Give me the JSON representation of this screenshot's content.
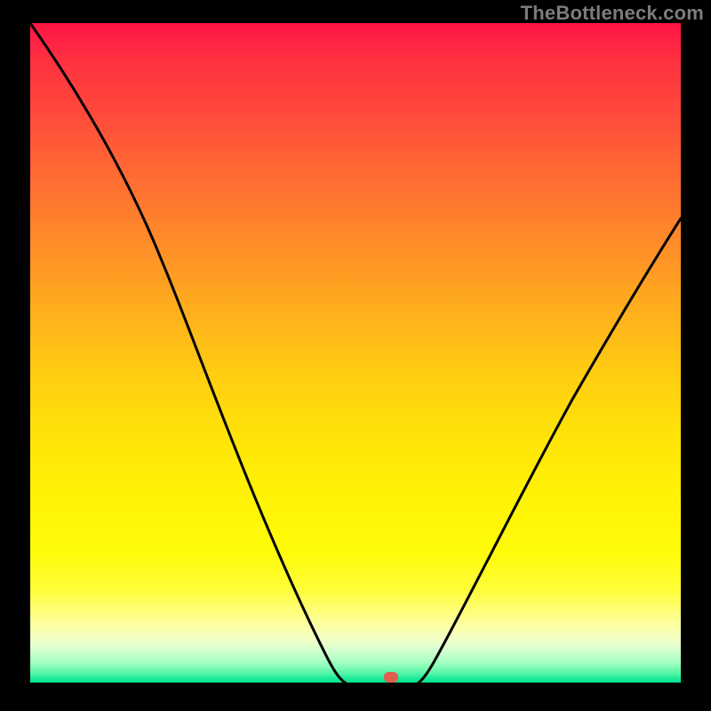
{
  "brand": {
    "watermark": "TheBottleneck.com",
    "accent_red": "#ff1545",
    "accent_green": "#00e48f"
  },
  "chart_data": {
    "type": "line",
    "title": "",
    "xlabel": "",
    "ylabel": "",
    "xlim": [
      0,
      100
    ],
    "ylim": [
      0,
      100
    ],
    "x": [
      0,
      5,
      10,
      15,
      20,
      25,
      30,
      35,
      40,
      45,
      50,
      52,
      54,
      58,
      62,
      68,
      75,
      82,
      90,
      100
    ],
    "values": [
      100,
      93,
      86,
      80,
      73,
      64,
      52,
      40,
      28,
      16,
      5,
      1,
      0,
      0,
      4,
      12,
      24,
      37,
      52,
      71
    ],
    "marker": {
      "x": 55,
      "y": 0,
      "label": ""
    },
    "gradient_stops": [
      {
        "pct": 0,
        "color": "#ff1545"
      },
      {
        "pct": 30,
        "color": "#ff8e28"
      },
      {
        "pct": 55,
        "color": "#ffcf10"
      },
      {
        "pct": 80,
        "color": "#fffb08"
      },
      {
        "pct": 100,
        "color": "#00e48f"
      }
    ]
  }
}
